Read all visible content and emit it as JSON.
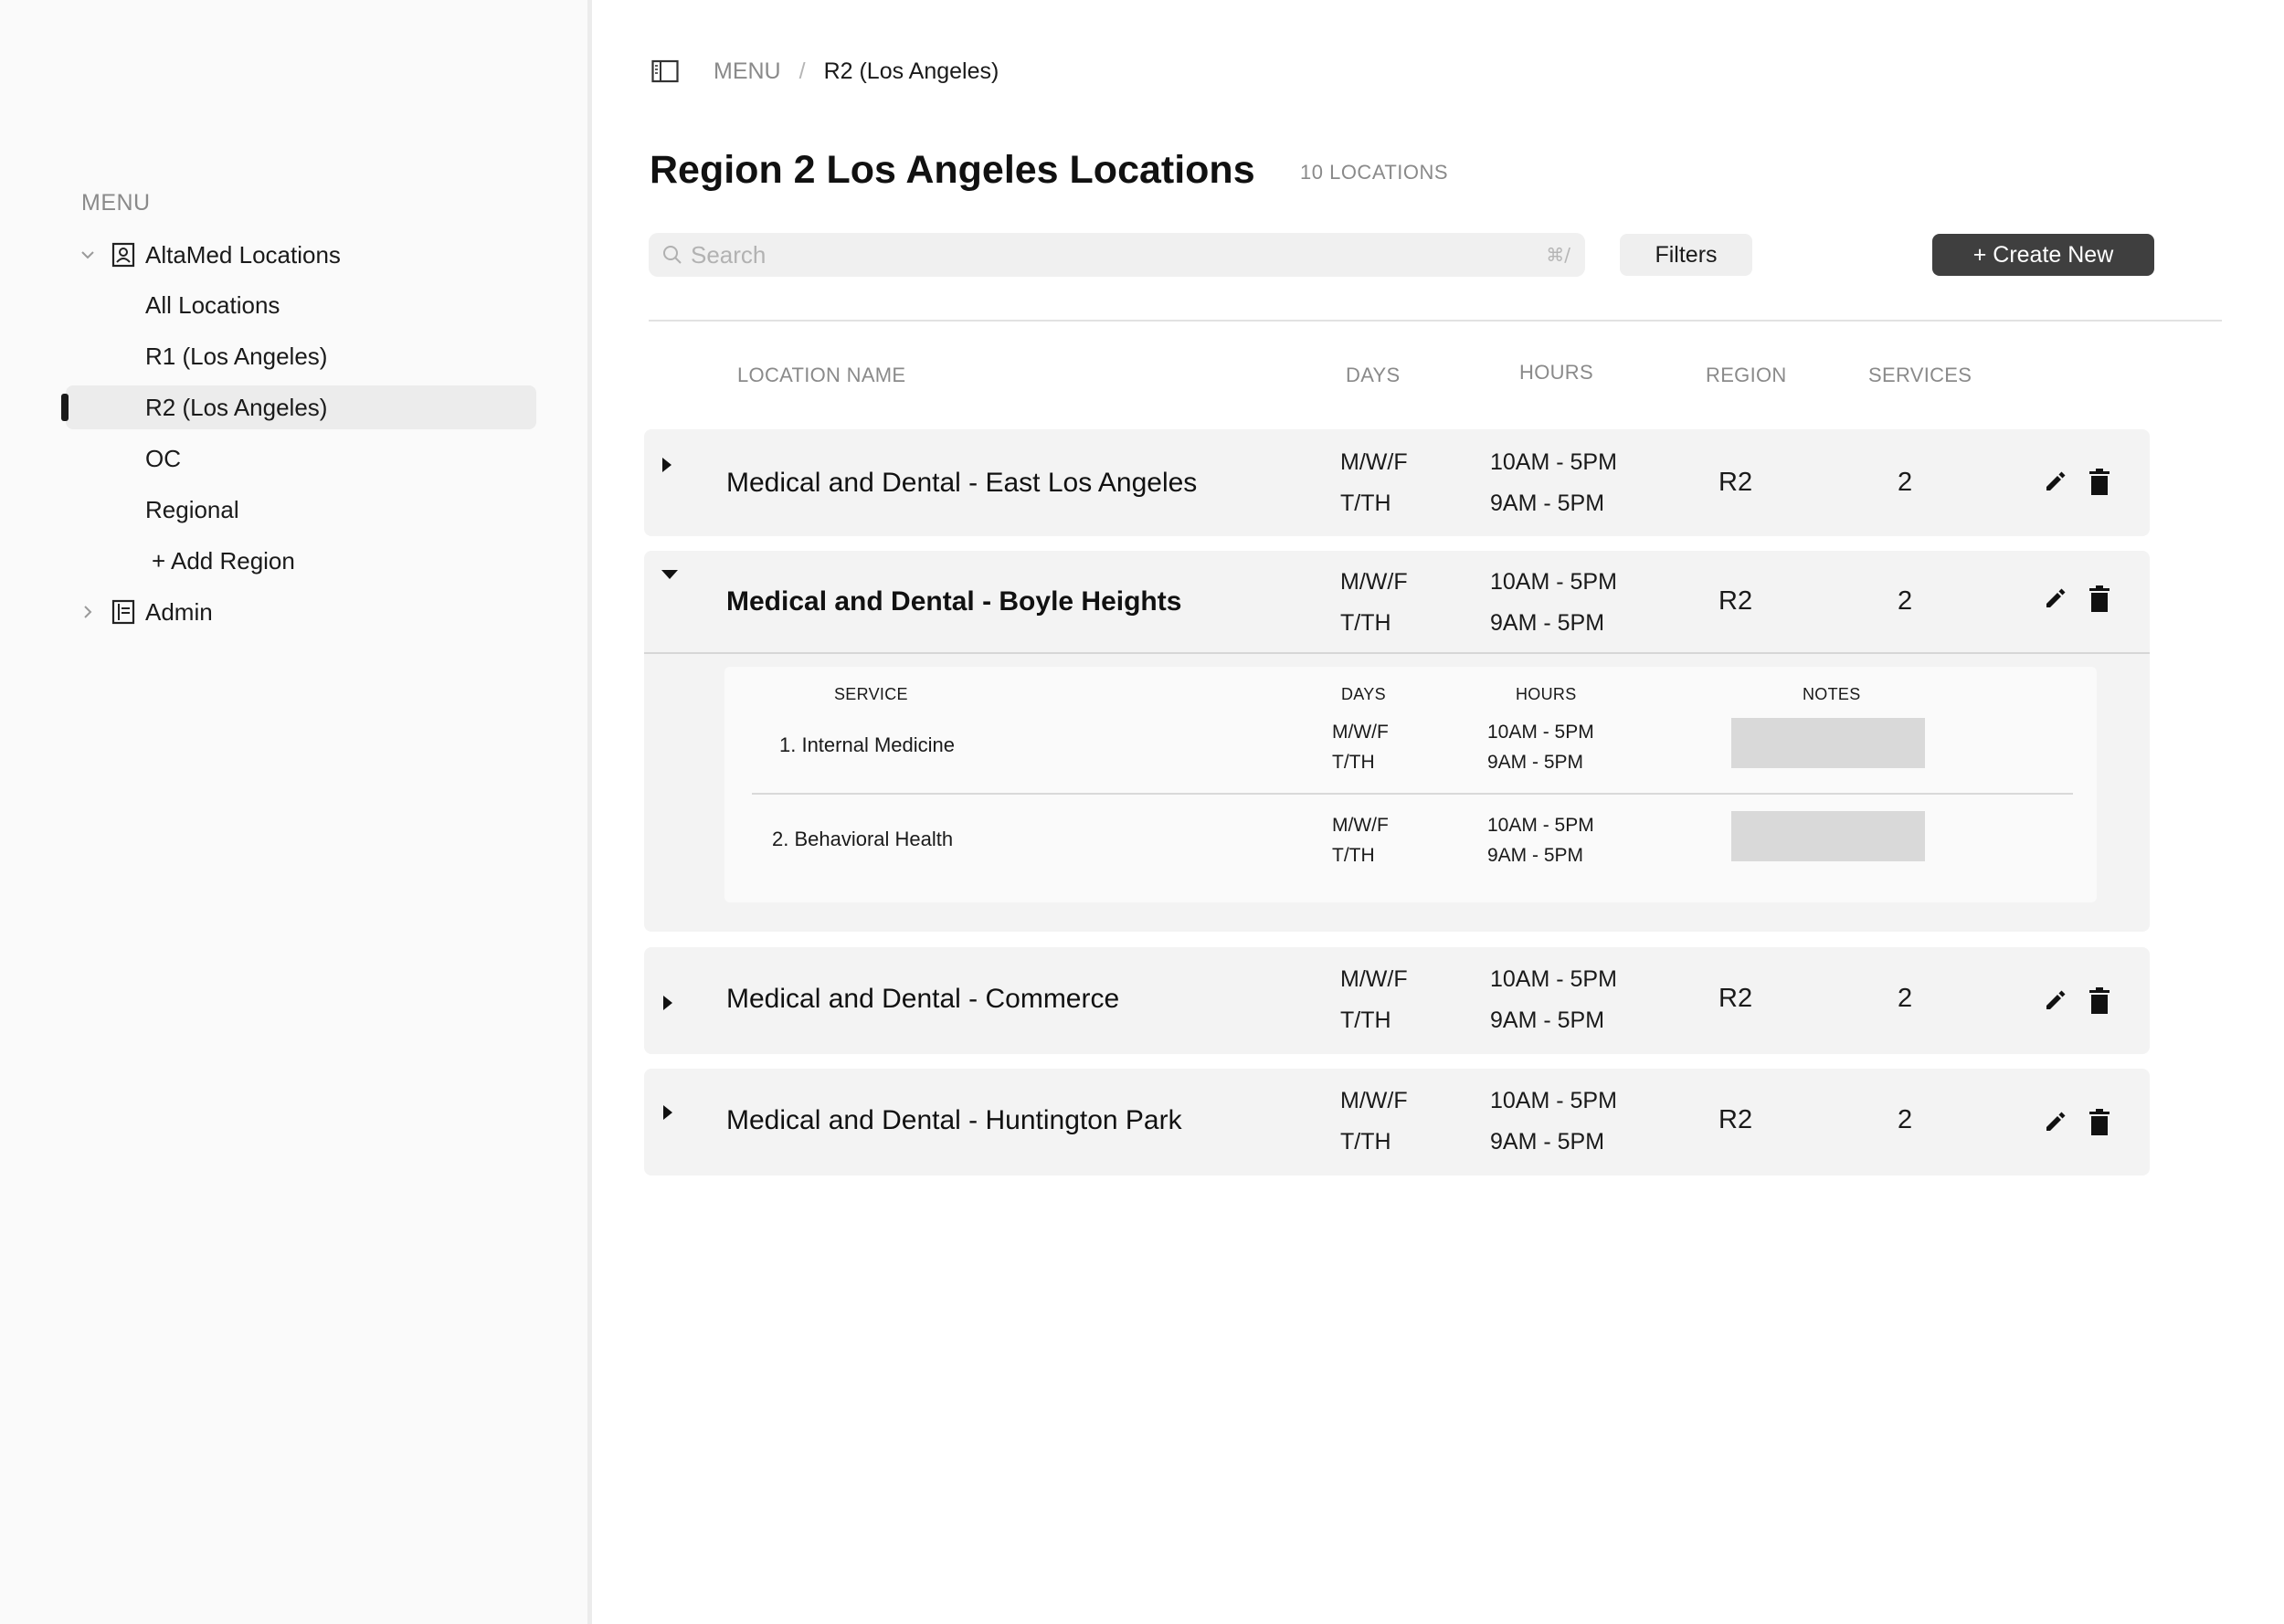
{
  "sidebar": {
    "menu_label": "MENU",
    "items": [
      {
        "label": "AltaMed Locations",
        "icon": "contact-card-icon",
        "expanded": true
      },
      {
        "label": "All Locations"
      },
      {
        "label": "R1 (Los Angeles)"
      },
      {
        "label": "R2 (Los Angeles)",
        "active": true
      },
      {
        "label": "OC"
      },
      {
        "label": "Regional"
      },
      {
        "label": "+ Add Region"
      },
      {
        "label": "Admin",
        "icon": "document-icon",
        "expanded": false
      }
    ]
  },
  "breadcrumb": {
    "root": "MENU",
    "separator": "/",
    "current": "R2 (Los Angeles)"
  },
  "page": {
    "title": "Region 2 Los Angeles Locations",
    "count": "10 LOCATIONS"
  },
  "toolbar": {
    "search_placeholder": "Search",
    "search_shortcut": "⌘/",
    "filters_label": "Filters",
    "create_label": "+ Create New"
  },
  "table": {
    "headers": {
      "name": "LOCATION NAME",
      "days": "DAYS",
      "hours": "HOURS",
      "region": "REGION",
      "services": "SERVICES"
    },
    "rows": [
      {
        "name": "Medical and Dental - East Los Angeles",
        "days": [
          "M/W/F",
          "T/TH"
        ],
        "hours": [
          "10AM - 5PM",
          "9AM - 5PM"
        ],
        "region": "R2",
        "services": "2",
        "expanded": false
      },
      {
        "name": "Medical and Dental - Boyle Heights",
        "days": [
          "M/W/F",
          "T/TH"
        ],
        "hours": [
          "10AM - 5PM",
          "9AM - 5PM"
        ],
        "region": "R2",
        "services": "2",
        "expanded": true
      },
      {
        "name": "Medical and Dental - Commerce",
        "days": [
          "M/W/F",
          "T/TH"
        ],
        "hours": [
          "10AM - 5PM",
          "9AM - 5PM"
        ],
        "region": "R2",
        "services": "2",
        "expanded": false
      },
      {
        "name": "Medical and Dental - Huntington Park",
        "days": [
          "M/W/F",
          "T/TH"
        ],
        "hours": [
          "10AM - 5PM",
          "9AM - 5PM"
        ],
        "region": "R2",
        "services": "2",
        "expanded": false
      }
    ]
  },
  "detail": {
    "headers": {
      "service": "SERVICE",
      "days": "DAYS",
      "hours": "HOURS",
      "notes": "NOTES"
    },
    "services": [
      {
        "name": "1. Internal Medicine",
        "days": [
          "M/W/F",
          "T/TH"
        ],
        "hours": [
          "10AM - 5PM",
          "9AM - 5PM"
        ]
      },
      {
        "name": "2. Behavioral Health",
        "days": [
          "M/W/F",
          "T/TH"
        ],
        "hours": [
          "10AM - 5PM",
          "9AM - 5PM"
        ]
      }
    ]
  },
  "colors": {
    "primary_button": "#3f3f3f",
    "active_nav_bg": "#ececec",
    "row_bg": "#f3f3f3",
    "note_placeholder": "#d9d9d9"
  }
}
